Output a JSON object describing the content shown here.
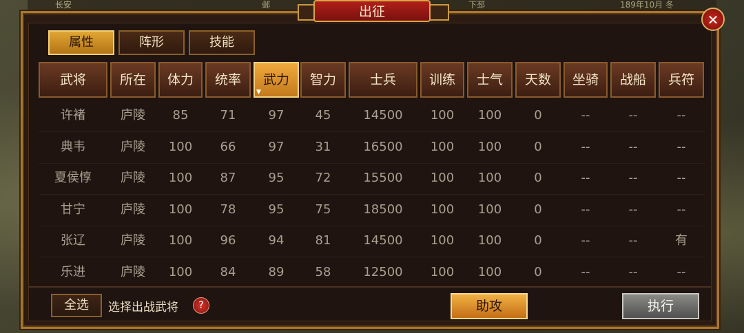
{
  "background": {
    "top_text": [
      "长安",
      "邺",
      "下邳"
    ],
    "date": "189年10月 冬"
  },
  "title": "出征",
  "tabs": [
    {
      "label": "属性",
      "active": true
    },
    {
      "label": "阵形",
      "active": false
    },
    {
      "label": "技能",
      "active": false
    }
  ],
  "columns": [
    "武将",
    "所在",
    "体力",
    "统率",
    "武力",
    "智力",
    "士兵",
    "训练",
    "士气",
    "天数",
    "坐骑",
    "战船",
    "兵符"
  ],
  "sorted_column": "武力",
  "rows": [
    [
      "许褚",
      "庐陵",
      "85",
      "71",
      "97",
      "45",
      "14500",
      "100",
      "100",
      "0",
      "--",
      "--",
      "--"
    ],
    [
      "典韦",
      "庐陵",
      "100",
      "66",
      "97",
      "31",
      "16500",
      "100",
      "100",
      "0",
      "--",
      "--",
      "--"
    ],
    [
      "夏侯惇",
      "庐陵",
      "100",
      "87",
      "95",
      "72",
      "15500",
      "100",
      "100",
      "0",
      "--",
      "--",
      "--"
    ],
    [
      "甘宁",
      "庐陵",
      "100",
      "78",
      "95",
      "75",
      "18500",
      "100",
      "100",
      "0",
      "--",
      "--",
      "--"
    ],
    [
      "张辽",
      "庐陵",
      "100",
      "96",
      "94",
      "81",
      "14500",
      "100",
      "100",
      "0",
      "--",
      "--",
      "有"
    ],
    [
      "乐进",
      "庐陵",
      "100",
      "84",
      "89",
      "58",
      "12500",
      "100",
      "100",
      "0",
      "--",
      "--",
      "--"
    ]
  ],
  "footer": {
    "select_all": "全选",
    "hint": "选择出战武将",
    "help": "?",
    "assist": "助攻",
    "execute": "执行"
  },
  "icons": {
    "close": "close-icon",
    "help": "help-icon",
    "sort": "sort-indicator-icon"
  }
}
